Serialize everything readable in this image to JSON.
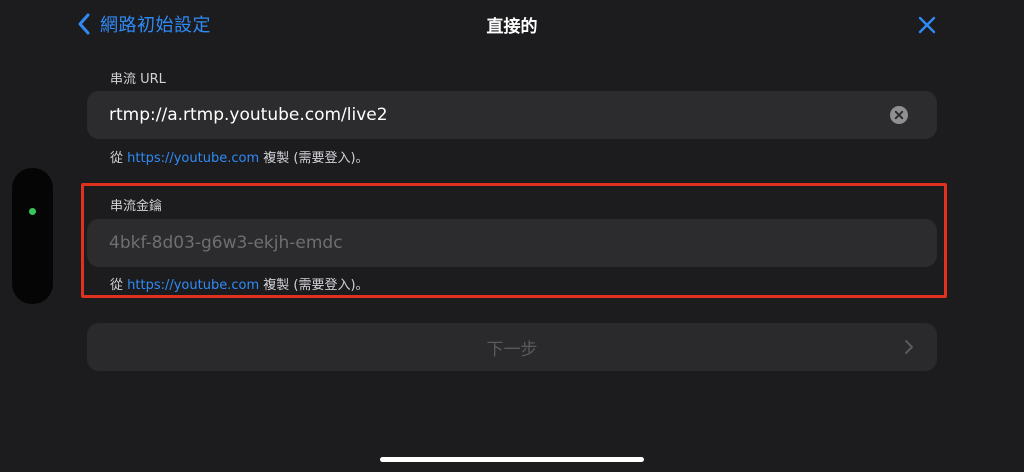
{
  "nav": {
    "back_label": "網路初始設定",
    "title": "直接的"
  },
  "stream_url": {
    "label": "串流 URL",
    "value": "rtmp://a.rtmp.youtube.com/live2",
    "hint_prefix": "從 ",
    "hint_link": "https://youtube.com",
    "hint_suffix": " 複製 (需要登入)。"
  },
  "stream_key": {
    "label": "串流金鑰",
    "placeholder": "4bkf-8d03-g6w3-ekjh-emdc",
    "hint_prefix": "從 ",
    "hint_link": "https://youtube.com",
    "hint_suffix": " 複製 (需要登入)。"
  },
  "next_button": {
    "label": "下一步"
  },
  "colors": {
    "accent": "#2f8af5",
    "highlight": "#e0311e",
    "status_dot": "#34c759"
  }
}
